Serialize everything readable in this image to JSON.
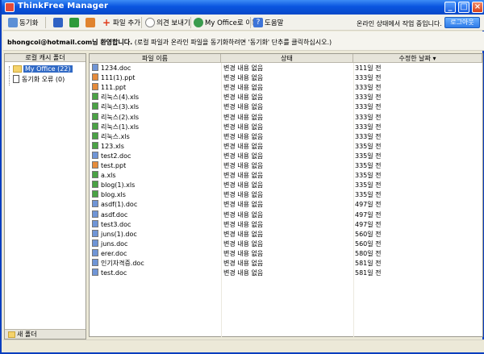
{
  "window": {
    "title": "ThinkFree Manager"
  },
  "toolbar": {
    "sync_label": "동기화",
    "add_file_label": "파일 추가",
    "feedback_label": "의견 보내기",
    "myoffice_label": "My Office로 이동",
    "help_label": "도움말",
    "status_message": "온라인 상태에서 작업 중입니다.",
    "login_label": "로그아웃"
  },
  "welcome": {
    "user": "bhongcoi@hotmail.com님 환영합니다.",
    "message": "(로컬 파일과 온라인 파일을 동기화하려면 '동기화' 단추를 클릭하십시오.)"
  },
  "sidebar": {
    "header": "로컬 캐시 폴더",
    "items": [
      {
        "label": "My Office (22)",
        "icon": "folder-icon",
        "selected": true
      },
      {
        "label": "동기화 오류 (0)",
        "icon": "document-icon",
        "selected": false
      }
    ],
    "new_folder_label": "새 폴더"
  },
  "table": {
    "columns": [
      "파일 이름",
      "상태",
      "수정한 날짜"
    ],
    "rows": [
      {
        "name": "1234.doc",
        "type": "doc",
        "status": "변경 내용 없음",
        "date": "311일 전"
      },
      {
        "name": "111(1).ppt",
        "type": "ppt",
        "status": "변경 내용 없음",
        "date": "333일 전"
      },
      {
        "name": "111.ppt",
        "type": "ppt",
        "status": "변경 내용 없음",
        "date": "333일 전"
      },
      {
        "name": "리눅스(4).xls",
        "type": "xls",
        "status": "변경 내용 없음",
        "date": "333일 전"
      },
      {
        "name": "리눅스(3).xls",
        "type": "xls",
        "status": "변경 내용 없음",
        "date": "333일 전"
      },
      {
        "name": "리눅스(2).xls",
        "type": "xls",
        "status": "변경 내용 없음",
        "date": "333일 전"
      },
      {
        "name": "리눅스(1).xls",
        "type": "xls",
        "status": "변경 내용 없음",
        "date": "333일 전"
      },
      {
        "name": "리눅스.xls",
        "type": "xls",
        "status": "변경 내용 없음",
        "date": "333일 전"
      },
      {
        "name": "123.xls",
        "type": "xls",
        "status": "변경 내용 없음",
        "date": "335일 전"
      },
      {
        "name": "test2.doc",
        "type": "doc",
        "status": "변경 내용 없음",
        "date": "335일 전"
      },
      {
        "name": "test.ppt",
        "type": "ppt",
        "status": "변경 내용 없음",
        "date": "335일 전"
      },
      {
        "name": "a.xls",
        "type": "xls",
        "status": "변경 내용 없음",
        "date": "335일 전"
      },
      {
        "name": "blog(1).xls",
        "type": "xls",
        "status": "변경 내용 없음",
        "date": "335일 전"
      },
      {
        "name": "blog.xls",
        "type": "xls",
        "status": "변경 내용 없음",
        "date": "335일 전"
      },
      {
        "name": "asdf(1).doc",
        "type": "doc",
        "status": "변경 내용 없음",
        "date": "497일 전"
      },
      {
        "name": "asdf.doc",
        "type": "doc",
        "status": "변경 내용 없음",
        "date": "497일 전"
      },
      {
        "name": "test3.doc",
        "type": "doc",
        "status": "변경 내용 없음",
        "date": "497일 전"
      },
      {
        "name": "juns(1).doc",
        "type": "doc",
        "status": "변경 내용 없음",
        "date": "560일 전"
      },
      {
        "name": "juns.doc",
        "type": "doc",
        "status": "변경 내용 없음",
        "date": "560일 전"
      },
      {
        "name": "erer.doc",
        "type": "doc",
        "status": "변경 내용 없음",
        "date": "580일 전"
      },
      {
        "name": "인기자격증.doc",
        "type": "doc",
        "status": "변경 내용 없음",
        "date": "581일 전"
      },
      {
        "name": "test.doc",
        "type": "doc",
        "status": "변경 내용 없음",
        "date": "581일 전"
      }
    ]
  }
}
